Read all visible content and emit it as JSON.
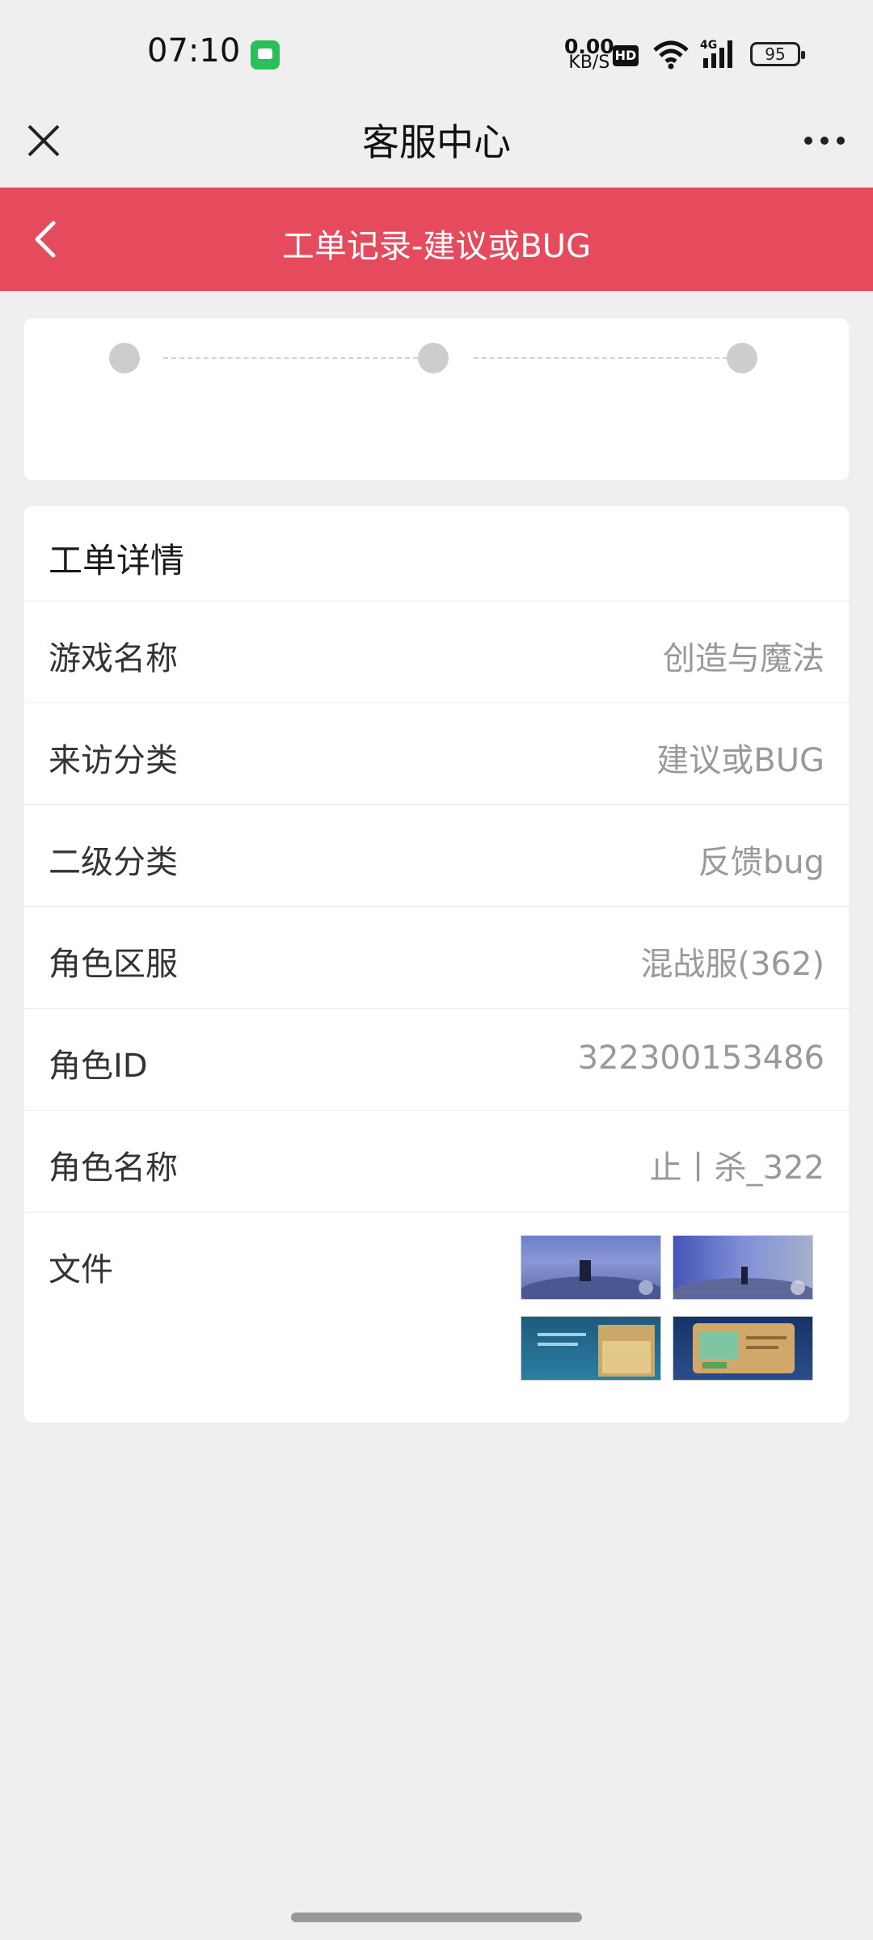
{
  "status": {
    "time": "07:10",
    "net_speed_value": "0.00",
    "net_speed_unit": "KB/S",
    "hd": "HD",
    "battery": "95"
  },
  "titlebar": {
    "title": "客服中心"
  },
  "header": {
    "title": "工单记录-建议或BUG"
  },
  "details": {
    "heading": "工单详情",
    "rows": [
      {
        "label": "游戏名称",
        "value": "创造与魔法"
      },
      {
        "label": "来访分类",
        "value": "建议或BUG"
      },
      {
        "label": "二级分类",
        "value": "反馈bug"
      },
      {
        "label": "角色区服",
        "value": "混战服(362)"
      },
      {
        "label": "角色ID",
        "value": "322300153486"
      },
      {
        "label": "角色名称",
        "value": "止丨杀_322"
      }
    ],
    "files_label": "文件"
  },
  "colors": {
    "accent": "#e54b5d",
    "background": "#efefef"
  }
}
